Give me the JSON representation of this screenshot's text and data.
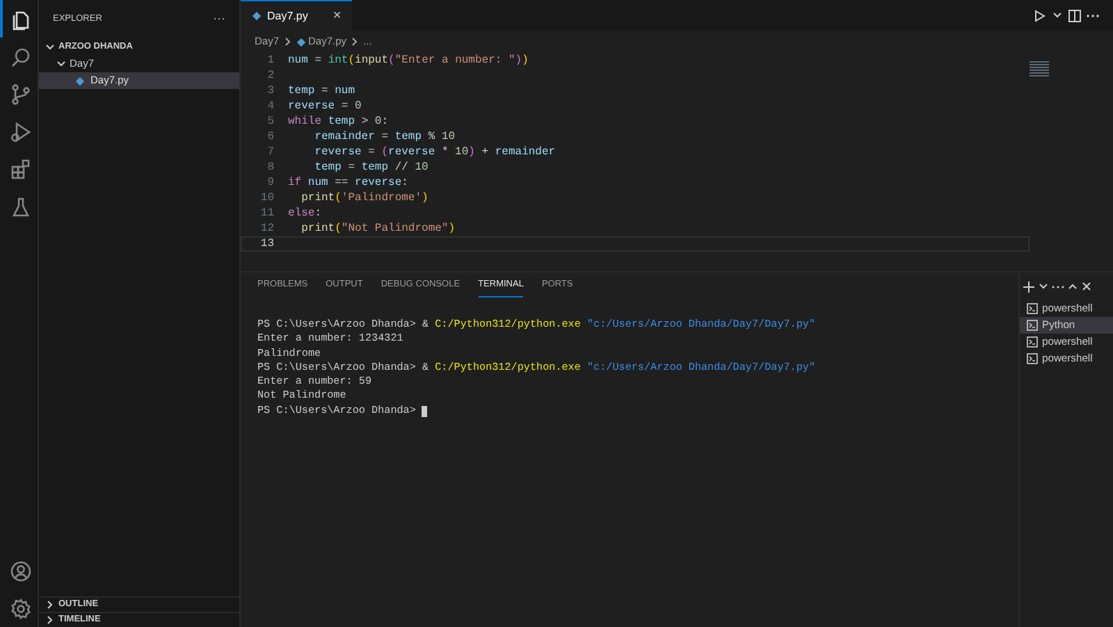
{
  "activity_bar": {
    "items": [
      {
        "selected": true
      },
      {
        "selected": false
      },
      {
        "selected": false
      },
      {
        "selected": false
      },
      {
        "selected": false
      },
      {
        "selected": false
      }
    ]
  },
  "sidebar": {
    "title": "EXPLORER",
    "more": "···",
    "tree": [
      {
        "label": "ARZOO DHANDA",
        "kind": "root",
        "expanded": true,
        "selected": false,
        "children": [
          {
            "label": "Day7",
            "kind": "folder",
            "expanded": true,
            "selected": false,
            "children": [
              {
                "label": "Day7.py",
                "kind": "file",
                "selected": true
              }
            ]
          }
        ]
      }
    ],
    "sections": [
      {
        "label": "OUTLINE",
        "expanded": false
      },
      {
        "label": "TIMELINE",
        "expanded": false
      }
    ]
  },
  "editor": {
    "tabs": [
      {
        "label": "Day7.py",
        "selected": true,
        "close": "×"
      }
    ],
    "breadcrumbs": [
      "Day7",
      "Day7.py",
      "..."
    ],
    "lines": [
      {
        "number": "1",
        "tokens": [
          {
            "text": "num",
            "kind": "var"
          },
          {
            "text": " = ",
            "kind": "op"
          },
          {
            "text": "int",
            "kind": "type"
          },
          {
            "text": "(",
            "kind": "brace"
          },
          {
            "text": "input",
            "kind": "fn"
          },
          {
            "text": "(",
            "kind": "brace2"
          },
          {
            "text": "\"Enter a number: \"",
            "kind": "str"
          },
          {
            "text": ")",
            "kind": "brace2"
          },
          {
            "text": ")",
            "kind": "brace"
          }
        ]
      },
      {
        "number": "2"
      },
      {
        "number": "3",
        "tokens": [
          {
            "text": "temp",
            "kind": "var"
          },
          {
            "text": " = ",
            "kind": "op"
          },
          {
            "text": "num",
            "kind": "var"
          }
        ]
      },
      {
        "number": "4",
        "tokens": [
          {
            "text": "reverse",
            "kind": "var"
          },
          {
            "text": " = ",
            "kind": "op"
          },
          {
            "text": "0",
            "kind": "num"
          }
        ]
      },
      {
        "number": "5",
        "tokens": [
          {
            "text": "while ",
            "kind": "kw"
          },
          {
            "text": "temp",
            "kind": "var"
          },
          {
            "text": " > ",
            "kind": "op"
          },
          {
            "text": "0",
            "kind": "num"
          },
          {
            "text": ":",
            "kind": "op"
          }
        ]
      },
      {
        "number": "6",
        "tokens": [
          {
            "text": "    remainder",
            "kind": "var"
          },
          {
            "text": " = ",
            "kind": "op"
          },
          {
            "text": "temp",
            "kind": "var"
          },
          {
            "text": " % ",
            "kind": "op"
          },
          {
            "text": "10",
            "kind": "num"
          }
        ]
      },
      {
        "number": "7",
        "tokens": [
          {
            "text": "    reverse",
            "kind": "var"
          },
          {
            "text": " = ",
            "kind": "op"
          },
          {
            "text": "(",
            "kind": "brace2"
          },
          {
            "text": "reverse",
            "kind": "var"
          },
          {
            "text": " * ",
            "kind": "op"
          },
          {
            "text": "10",
            "kind": "num"
          },
          {
            "text": ")",
            "kind": "brace2"
          },
          {
            "text": " + ",
            "kind": "op"
          },
          {
            "text": "remainder",
            "kind": "var"
          }
        ]
      },
      {
        "number": "8",
        "tokens": [
          {
            "text": "    temp",
            "kind": "var"
          },
          {
            "text": " = ",
            "kind": "op"
          },
          {
            "text": "temp",
            "kind": "var"
          },
          {
            "text": " // ",
            "kind": "op"
          },
          {
            "text": "10",
            "kind": "num"
          }
        ]
      },
      {
        "number": "9",
        "tokens": [
          {
            "text": "if ",
            "kind": "kw"
          },
          {
            "text": "num",
            "kind": "var"
          },
          {
            "text": " == ",
            "kind": "op"
          },
          {
            "text": "reverse",
            "kind": "var"
          },
          {
            "text": ":",
            "kind": "op"
          }
        ]
      },
      {
        "number": "10",
        "tokens": [
          {
            "text": "  print",
            "kind": "fn"
          },
          {
            "text": "(",
            "kind": "brace"
          },
          {
            "text": "'Palindrome'",
            "kind": "str"
          },
          {
            "text": ")",
            "kind": "brace"
          }
        ]
      },
      {
        "number": "11",
        "tokens": [
          {
            "text": "else",
            "kind": "kw"
          },
          {
            "text": ":",
            "kind": "op"
          }
        ]
      },
      {
        "number": "12",
        "tokens": [
          {
            "text": "  print",
            "kind": "fn"
          },
          {
            "text": "(",
            "kind": "brace"
          },
          {
            "text": "\"Not Palindrome\"",
            "kind": "str"
          },
          {
            "text": ")",
            "kind": "brace"
          }
        ]
      },
      {
        "number": "13",
        "current": true
      }
    ]
  },
  "panel": {
    "tabs": [
      {
        "label": "PROBLEMS",
        "selected": false
      },
      {
        "label": "OUTPUT",
        "selected": false
      },
      {
        "label": "DEBUG CONSOLE",
        "selected": false
      },
      {
        "label": "TERMINAL",
        "selected": true
      },
      {
        "label": "PORTS",
        "selected": false
      }
    ],
    "terminal": [
      [
        {
          "text": "PS C:\\Users\\Arzoo Dhanda> & ",
          "kind": "plain"
        },
        {
          "text": "C:/Python312/python.exe",
          "kind": "cmd"
        },
        {
          "text": " \"c:/Users/Arzoo Dhanda/Day7/Day7.py\"",
          "kind": "str"
        }
      ],
      [
        {
          "text": "Enter a number: 1234321",
          "kind": "plain"
        }
      ],
      [
        {
          "text": "Palindrome",
          "kind": "plain"
        }
      ],
      [
        {
          "text": "PS C:\\Users\\Arzoo Dhanda> & ",
          "kind": "plain"
        },
        {
          "text": "C:/Python312/python.exe",
          "kind": "cmd"
        },
        {
          "text": " \"c:/Users/Arzoo Dhanda/Day7/Day7.py\"",
          "kind": "str"
        }
      ],
      [
        {
          "text": "Enter a number: 59",
          "kind": "plain"
        }
      ],
      [
        {
          "text": "Not Palindrome",
          "kind": "plain"
        }
      ],
      [
        {
          "text": "PS C:\\Users\\Arzoo Dhanda> ",
          "kind": "plain"
        }
      ]
    ],
    "cursor": true,
    "terminals": [
      {
        "label": "powershell",
        "selected": false
      },
      {
        "label": "Python",
        "selected": true
      },
      {
        "label": "powershell",
        "selected": false
      },
      {
        "label": "powershell",
        "selected": false
      }
    ]
  }
}
